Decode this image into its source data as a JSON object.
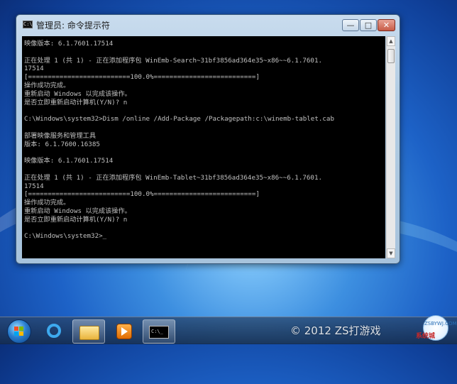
{
  "window": {
    "title": "管理员: 命令提示符",
    "icon": "cmd-icon",
    "controls": {
      "minimize": "—",
      "maximize": "□",
      "close": "✕"
    }
  },
  "console": {
    "text": "映像版本: 6.1.7601.17514\n\n正在处理 1 (共 1) - 正在添加程序包 WinEmb-Search~31bf3856ad364e35~x86~~6.1.7601.\n17514\n[==========================100.0%==========================]\n操作成功完成。\n重新启动 Windows 以完成该操作。\n是否立即重新启动计算机(Y/N)? n\n\nC:\\Windows\\system32>Dism /online /Add-Package /Packagepath:c:\\winemb-tablet.cab\n\n部署映像服务和管理工具\n版本: 6.1.7600.16385\n\n映像版本: 6.1.7601.17514\n\n正在处理 1 (共 1) - 正在添加程序包 WinEmb-Tablet~31bf3856ad364e35~x86~~6.1.7601.\n17514\n[==========================100.0%==========================]\n操作成功完成。\n重新启动 Windows 以完成该操作。\n是否立即重新启动计算机(Y/N)? n\n\nC:\\Windows\\system32>_"
  },
  "scrollbar": {
    "up_icon": "▲",
    "down_icon": "▼"
  },
  "taskbar": {
    "items": [
      {
        "name": "internet-explorer",
        "icon": "ie-icon"
      },
      {
        "name": "windows-explorer",
        "icon": "folder-icon"
      },
      {
        "name": "media-player",
        "icon": "media-player-icon"
      },
      {
        "name": "command-prompt",
        "icon": "cmd-icon",
        "label": "C:\\_"
      }
    ]
  },
  "watermark": {
    "text": "© 2012 ZS打游戏",
    "site_domain": "ZSBYWJ.COM",
    "site_name": "系统城"
  },
  "colors": {
    "console_bg": "#000000",
    "console_fg": "#c0c0c0",
    "close_button": "#c75b46"
  }
}
